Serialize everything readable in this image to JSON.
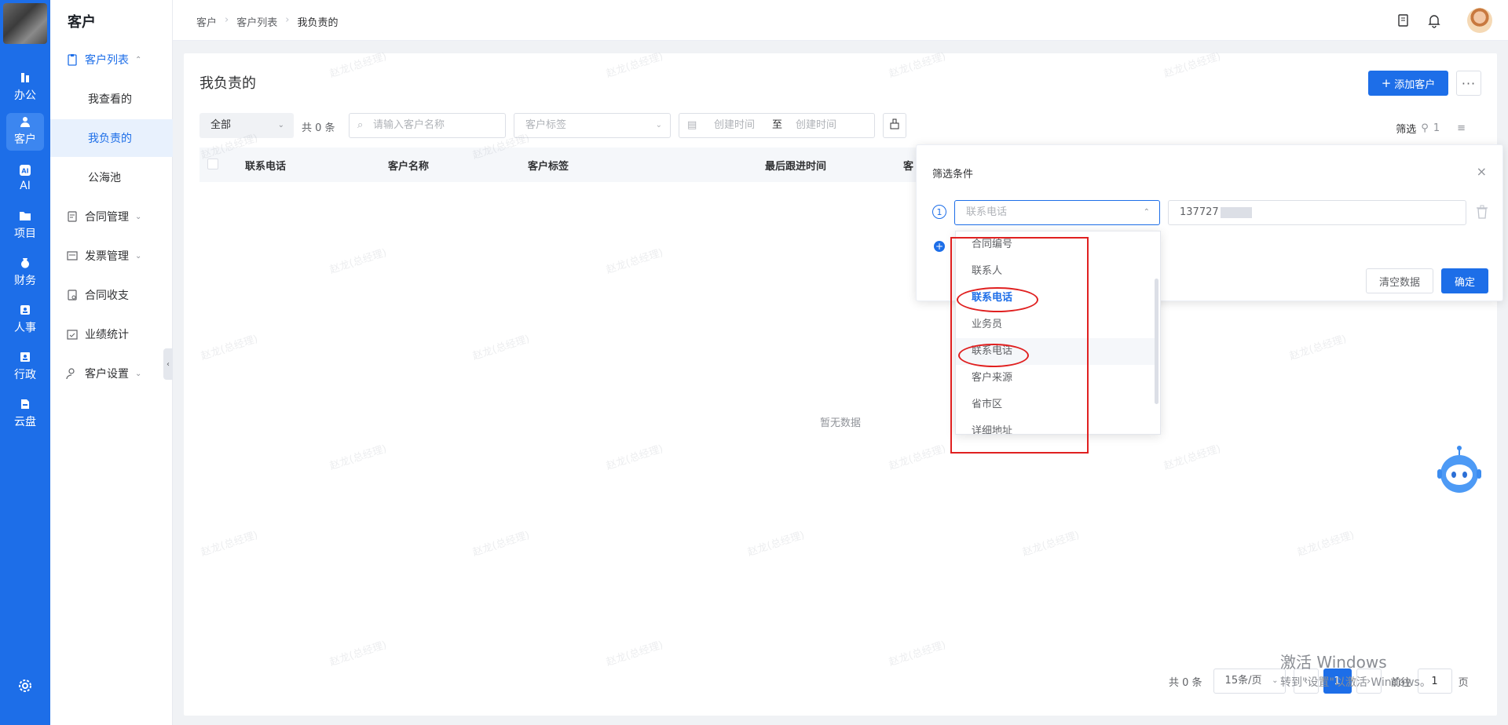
{
  "rail": {
    "items": [
      {
        "label": "办公",
        "icon": "office-icon"
      },
      {
        "label": "客户",
        "icon": "customer-icon"
      },
      {
        "label": "AI",
        "icon": "ai-icon"
      },
      {
        "label": "项目",
        "icon": "folder-icon"
      },
      {
        "label": "财务",
        "icon": "finance-icon"
      },
      {
        "label": "人事",
        "icon": "hr-icon"
      },
      {
        "label": "行政",
        "icon": "admin-icon"
      },
      {
        "label": "云盘",
        "icon": "cloud-disk-icon"
      }
    ]
  },
  "menu": {
    "title": "客户",
    "items": [
      {
        "label": "客户列表"
      },
      {
        "label": "我查看的"
      },
      {
        "label": "我负责的"
      },
      {
        "label": "公海池"
      },
      {
        "label": "合同管理"
      },
      {
        "label": "发票管理"
      },
      {
        "label": "合同收支"
      },
      {
        "label": "业绩统计"
      },
      {
        "label": "客户设置"
      }
    ]
  },
  "header": {
    "breadcrumb": [
      "客户",
      "客户列表",
      "我负责的"
    ]
  },
  "main": {
    "page_title": "我负责的",
    "add_button": "添加客户",
    "more_button": "···",
    "scope_select": "全部",
    "total_text": "共 0 条",
    "search_placeholder": "请输入客户名称",
    "tag_placeholder": "客户标签",
    "date_start_placeholder": "创建时间",
    "date_sep": "至",
    "date_end_placeholder": "创建时间",
    "filter_label": "筛选",
    "filter_count": "1",
    "columns": [
      "联系电话",
      "客户名称",
      "客户标签",
      "最后跟进时间",
      "客"
    ],
    "empty_text": "暂无数据"
  },
  "pagination": {
    "total": "共 0 条",
    "page_size": "15条/页",
    "current_page": "1",
    "goto_label": "前往",
    "goto_value": "1",
    "page_suffix": "页"
  },
  "filter_popover": {
    "title": "筛选条件",
    "step": "1",
    "field_value": "联系电话",
    "value_text": "137727",
    "clear_button": "清空数据",
    "confirm_button": "确定"
  },
  "dropdown": {
    "options": [
      "合同编号",
      "联系人",
      "联系电话",
      "业务员",
      "联系电话",
      "客户来源",
      "省市区",
      "详细地址"
    ],
    "selected_index": 2,
    "hover_index": 4
  },
  "watermark": "赵龙(总经理)",
  "windows_activation": {
    "line1": "激活 Windows",
    "line2": "转到\"设置\"以激活 Windows。"
  },
  "colors": {
    "primary": "#1d6ee8",
    "annotation": "#e02020"
  }
}
